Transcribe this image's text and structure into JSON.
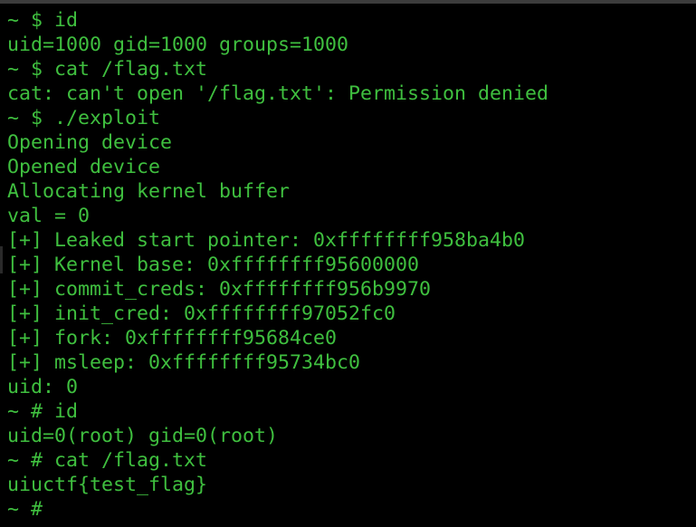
{
  "colors": {
    "background": "#000000",
    "foreground": "#3fbf3f",
    "frame": "#3c3c3c"
  },
  "terminal": {
    "lines": [
      "~ $ id",
      "uid=1000 gid=1000 groups=1000",
      "~ $ cat /flag.txt",
      "cat: can't open '/flag.txt': Permission denied",
      "~ $ ./exploit",
      "Opening device",
      "Opened device",
      "Allocating kernel buffer",
      "val = 0",
      "[+] Leaked start pointer: 0xffffffff958ba4b0",
      "[+] Kernel base: 0xffffffff95600000",
      "[+] commit_creds: 0xffffffff956b9970",
      "[+] init_cred: 0xffffffff97052fc0",
      "[+] fork: 0xffffffff95684ce0",
      "[+] msleep: 0xffffffff95734bc0",
      "uid: 0",
      "~ # id",
      "uid=0(root) gid=0(root)",
      "~ # cat /flag.txt",
      "uiuctf{test_flag}",
      "~ # "
    ]
  }
}
